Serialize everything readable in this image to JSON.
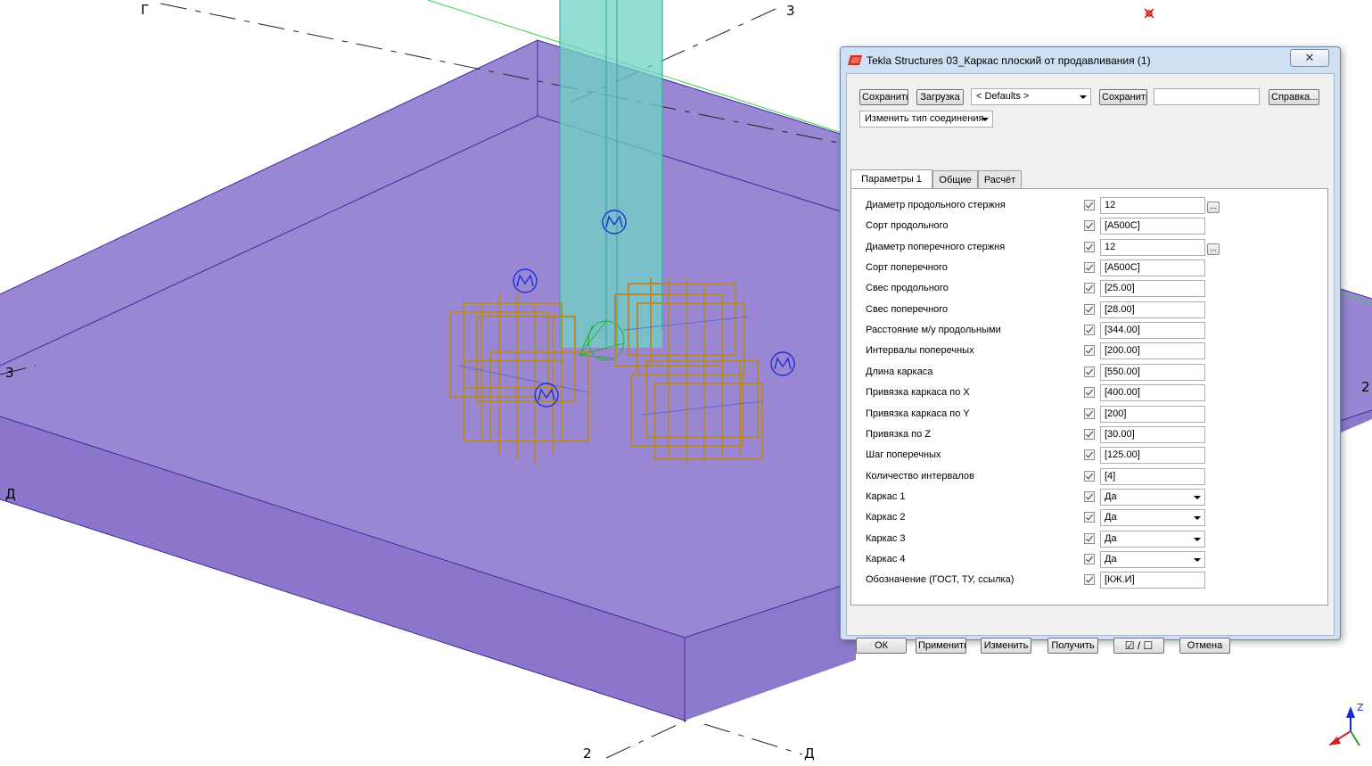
{
  "viewport": {
    "grid_labels": {
      "top_g": "Г",
      "top_3": "3",
      "left_3": "3",
      "left_d": "Д",
      "right_2": "2",
      "bottom_2": "2",
      "bottom_d": "Д"
    },
    "colors": {
      "slab_top": "#9a87d4",
      "slab_side": "#8b76cb",
      "column": "#6fd3c4",
      "rebar": "#b5893a",
      "marker": "#1f2fd6"
    }
  },
  "dialog": {
    "title": "Tekla Structures  03_Каркас плоский от продавливания (1)",
    "close_icon": "close-icon",
    "toolbar": {
      "save_label": "Сохранить",
      "load_label": "Загрузка",
      "defaults_value": "< Defaults >",
      "save_as_label": "Сохранить как",
      "help_label": "Справка...",
      "connection_type_value": "Изменить тип соединения"
    },
    "tabs": [
      {
        "label": "Параметры 1",
        "active": true
      },
      {
        "label": "Общие",
        "active": false
      },
      {
        "label": "Расчёт",
        "active": false
      }
    ],
    "params": [
      {
        "label": "Диаметр продольного стержня",
        "value": "12",
        "type": "text",
        "browse": true
      },
      {
        "label": "Сорт продольного",
        "value": "[A500C]",
        "type": "text"
      },
      {
        "label": "Диаметр поперечного стержня",
        "value": "12",
        "type": "text",
        "browse": true
      },
      {
        "label": "Сорт поперечного",
        "value": "[A500C]",
        "type": "text"
      },
      {
        "label": "Свес продольного",
        "value": "[25.00]",
        "type": "text"
      },
      {
        "label": "Свес поперечного",
        "value": "[28.00]",
        "type": "text"
      },
      {
        "label": "Расстояние м/у продольными",
        "value": "[344.00]",
        "type": "text"
      },
      {
        "label": "Интервалы поперечных",
        "value": "[200.00]",
        "type": "text"
      },
      {
        "label": "Длина каркаса",
        "value": "[550.00]",
        "type": "text"
      },
      {
        "label": "Привязка каркаса по X",
        "value": "[400.00]",
        "type": "text"
      },
      {
        "label": "Привязка каркаса по Y",
        "value": "[200]",
        "type": "text"
      },
      {
        "label": "Привязка по Z",
        "value": "[30.00]",
        "type": "text"
      },
      {
        "label": "Шаг поперечных",
        "value": "[125.00]",
        "type": "text"
      },
      {
        "label": "Количество интервалов",
        "value": "[4]",
        "type": "text"
      },
      {
        "label": "Каркас 1",
        "value": "Да",
        "type": "select"
      },
      {
        "label": "Каркас 2",
        "value": "Да",
        "type": "select"
      },
      {
        "label": "Каркас 3",
        "value": "Да",
        "type": "select"
      },
      {
        "label": "Каркас 4",
        "value": "Да",
        "type": "select"
      },
      {
        "label": "Обозначение (ГОСТ, ТУ, ссылка)",
        "value": "[КЖ.И]",
        "type": "text"
      }
    ],
    "browse_label": "...",
    "footer": {
      "ok_label": "ОК",
      "apply_label": "Применить",
      "modify_label": "Изменить",
      "get_label": "Получить",
      "toggle_label": "☑ / ☐",
      "cancel_label": "Отмена"
    }
  }
}
